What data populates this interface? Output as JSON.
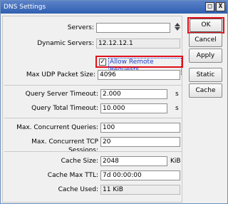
{
  "window": {
    "title": "DNS Settings",
    "maximize_glyph": "□",
    "close_glyph": "X"
  },
  "form": {
    "servers": {
      "label": "Servers:",
      "value": ""
    },
    "dynamic_servers": {
      "label": "Dynamic Servers:",
      "value": "12.12.12.1"
    },
    "allow_remote_requests": {
      "label": "Allow Remote Requests",
      "checked": true,
      "check_glyph": "✓"
    },
    "max_udp_packet_size": {
      "label": "Max UDP Packet Size:",
      "value": "4096"
    },
    "query_server_timeout": {
      "label": "Query Server Timeout:",
      "value": "2.000",
      "unit": "s"
    },
    "query_total_timeout": {
      "label": "Query Total Timeout:",
      "value": "10.000",
      "unit": "s"
    },
    "max_concurrent_queries": {
      "label": "Max. Concurrent Queries:",
      "value": "100"
    },
    "max_concurrent_tcp_sessions": {
      "label": "Max. Concurrent TCP Sessions:",
      "value": "20"
    },
    "cache_size": {
      "label": "Cache Size:",
      "value": "2048",
      "unit": "KiB"
    },
    "cache_max_ttl": {
      "label": "Cache Max TTL:",
      "value": "7d 00:00:00"
    },
    "cache_used": {
      "label": "Cache Used:",
      "value": "11 KiB"
    }
  },
  "buttons": {
    "ok": "OK",
    "cancel": "Cancel",
    "apply": "Apply",
    "static": "Static",
    "cache": "Cache"
  },
  "colors": {
    "highlight": "#e0101a",
    "titlebar": "#2f5fb0",
    "link_text": "#1d3ec8"
  }
}
